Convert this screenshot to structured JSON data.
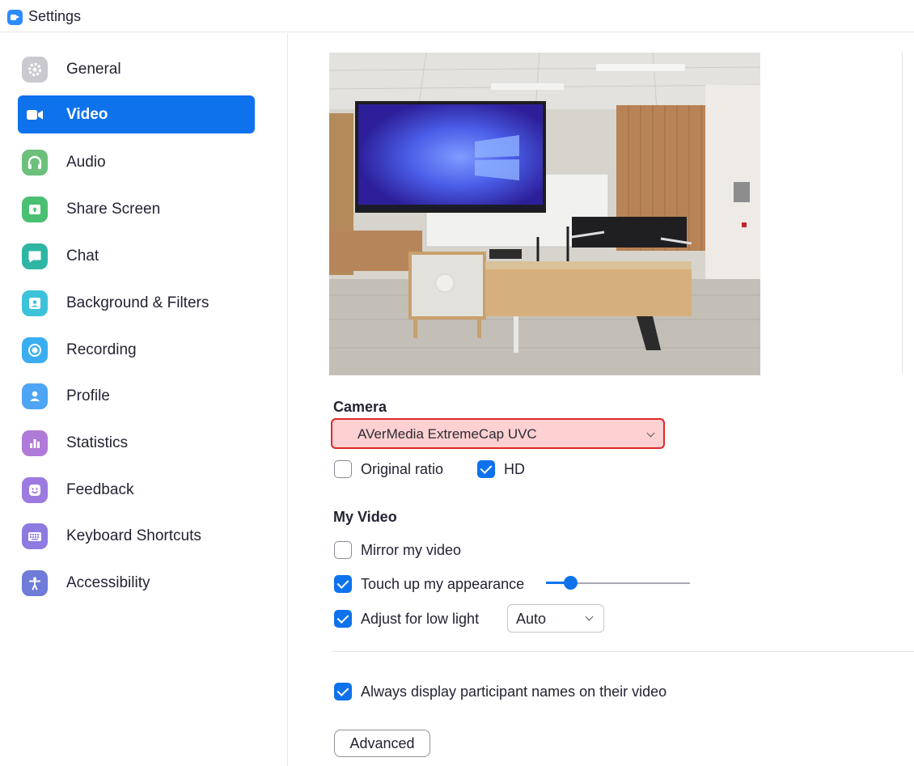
{
  "window": {
    "title": "Settings"
  },
  "sidebar": {
    "items": [
      {
        "label": "General",
        "icon": "gear-icon",
        "color": "#c9c9cf",
        "active": false
      },
      {
        "label": "Video",
        "icon": "video-camera-icon",
        "color": "#0e72ed",
        "active": true
      },
      {
        "label": "Audio",
        "icon": "headphones-icon",
        "color": "#6cc07b",
        "active": false
      },
      {
        "label": "Share Screen",
        "icon": "share-screen-icon",
        "color": "#4bbf72",
        "active": false
      },
      {
        "label": "Chat",
        "icon": "chat-bubble-icon",
        "color": "#2fb5a4",
        "active": false
      },
      {
        "label": "Background & Filters",
        "icon": "background-person-icon",
        "color": "#3cc3d9",
        "active": false
      },
      {
        "label": "Recording",
        "icon": "record-icon",
        "color": "#3aaef0",
        "active": false
      },
      {
        "label": "Profile",
        "icon": "person-icon",
        "color": "#4ea4f5",
        "active": false
      },
      {
        "label": "Statistics",
        "icon": "bar-chart-icon",
        "color": "#b07ad8",
        "active": false
      },
      {
        "label": "Feedback",
        "icon": "smiley-icon",
        "color": "#9d7ae0",
        "active": false
      },
      {
        "label": "Keyboard Shortcuts",
        "icon": "keyboard-icon",
        "color": "#8e7ae0",
        "active": false
      },
      {
        "label": "Accessibility",
        "icon": "accessibility-person-icon",
        "color": "#6f7bd8",
        "active": false
      }
    ]
  },
  "video": {
    "camera_title": "Camera",
    "camera_selected": "AVerMedia ExtremeCap UVC",
    "original_ratio_label": "Original ratio",
    "original_ratio_checked": false,
    "hd_label": "HD",
    "hd_checked": true,
    "my_video_title": "My Video",
    "mirror_label": "Mirror my video",
    "mirror_checked": false,
    "touch_up_label": "Touch up my appearance",
    "touch_up_checked": true,
    "touch_up_level": 0.17,
    "low_light_label": "Adjust for low light",
    "low_light_checked": true,
    "low_light_mode": "Auto",
    "names_label": "Always display participant names on their video",
    "names_checked": true,
    "advanced_label": "Advanced"
  },
  "colors": {
    "accent": "#0e72ed",
    "highlight_fill": "#fdd0d2",
    "highlight_border": "#e02828"
  }
}
